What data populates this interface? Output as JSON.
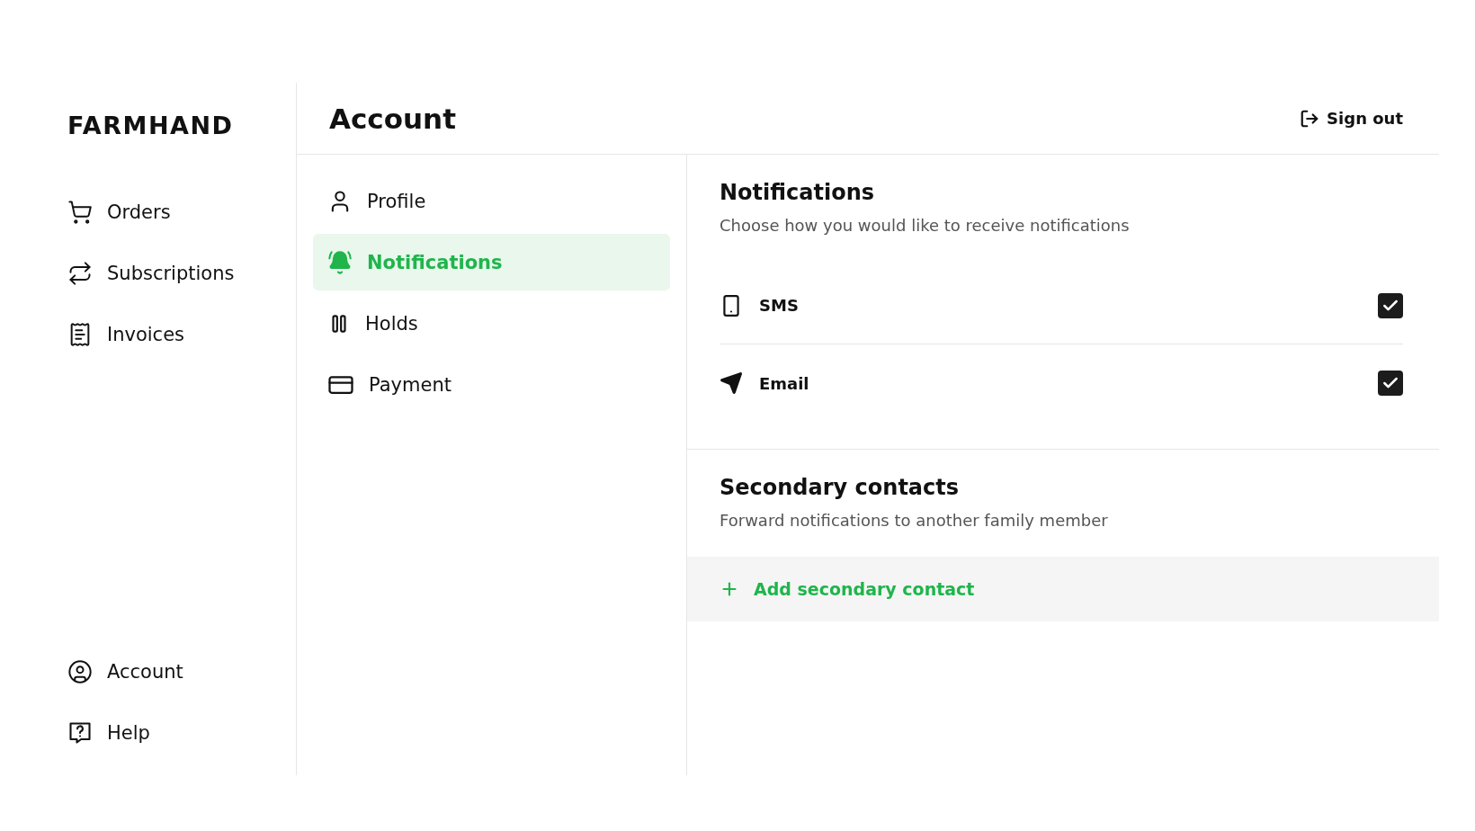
{
  "brand": "FARMHAND",
  "nav": {
    "main": [
      {
        "label": "Orders",
        "kind": "cart",
        "selected": false
      },
      {
        "label": "Subscriptions",
        "kind": "repeat",
        "selected": false
      },
      {
        "label": "Invoices",
        "kind": "receipt",
        "selected": false
      }
    ],
    "bottom": [
      {
        "label": "Account",
        "kind": "account",
        "selected": false
      },
      {
        "label": "Help",
        "kind": "help",
        "selected": false
      }
    ]
  },
  "header": {
    "title": "Account",
    "sign_out": "Sign out"
  },
  "submenu": [
    {
      "label": "Profile",
      "kind": "profile",
      "selected": false
    },
    {
      "label": "Notifications",
      "kind": "notifications",
      "selected": true
    },
    {
      "label": "Holds",
      "kind": "holds",
      "selected": false
    },
    {
      "label": "Payment",
      "kind": "payment",
      "selected": false
    }
  ],
  "notifications": {
    "title": "Notifications",
    "subtitle": "Choose how you would like to receive notifications",
    "channels": [
      {
        "label": "SMS",
        "kind": "sms",
        "checked": true
      },
      {
        "label": "Email",
        "kind": "email",
        "checked": true
      }
    ]
  },
  "secondary": {
    "title": "Secondary contacts",
    "subtitle": "Forward notifications to another family member",
    "add": "Add secondary contact"
  }
}
